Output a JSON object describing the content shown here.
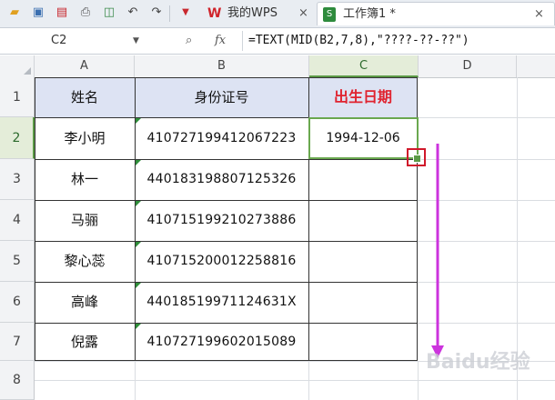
{
  "toolbar": {
    "icons": [
      "folder-icon",
      "save-icon",
      "export-pdf-icon",
      "print-icon",
      "print-preview-icon",
      "undo-icon",
      "redo-icon",
      "dropdown-icon"
    ]
  },
  "tabs": [
    {
      "label": "我的WPS",
      "close": "×"
    },
    {
      "label": "工作簿1 *",
      "close": "×"
    }
  ],
  "formula_bar": {
    "cell_ref": "C2",
    "fx_label": "fx",
    "formula": "=TEXT(MID(B2,7,8),\"????-??-??\")"
  },
  "columns": [
    "A",
    "B",
    "C",
    "D"
  ],
  "rows": [
    "1",
    "2",
    "3",
    "4",
    "5",
    "6",
    "7",
    "8"
  ],
  "table": {
    "headers": [
      "姓名",
      "身份证号",
      "出生日期"
    ],
    "records": [
      {
        "name": "李小明",
        "id": "410727199412067223",
        "birth": "1994-12-06"
      },
      {
        "name": "林一",
        "id": "440183198807125326",
        "birth": ""
      },
      {
        "name": "马骊",
        "id": "410715199210273886",
        "birth": ""
      },
      {
        "name": "黎心蕊",
        "id": "410715200012258816",
        "birth": ""
      },
      {
        "name": "高峰",
        "id": "44018519971124631X",
        "birth": ""
      },
      {
        "name": "倪露",
        "id": "410727199602015089",
        "birth": ""
      }
    ]
  },
  "colors": {
    "header_fill": "#dde3f3",
    "header_red": "#e0232f",
    "selection_green": "#6aa84f",
    "arrow_magenta": "#cc33dd",
    "handle_box_red": "#d0182a"
  },
  "watermark": "Baidu经验"
}
